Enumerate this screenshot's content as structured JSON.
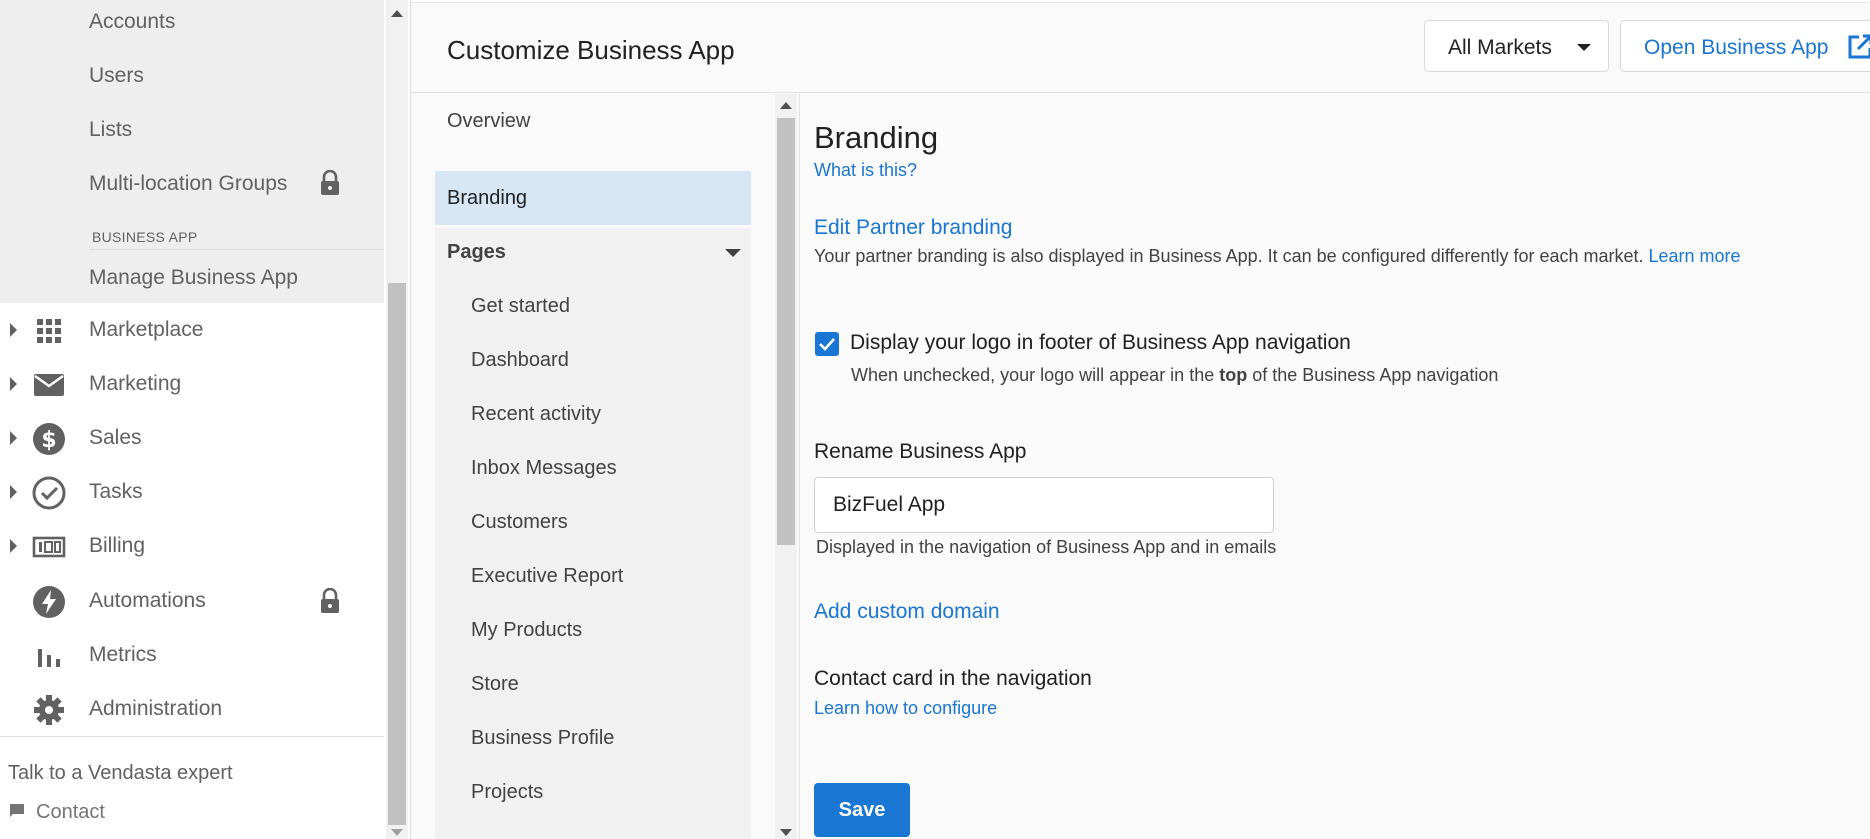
{
  "sidebar": {
    "sub_items": [
      "Accounts",
      "Users",
      "Lists",
      "Multi-location Groups"
    ],
    "section_label": "BUSINESS APP",
    "active_sub_item": "Manage Business App",
    "nav_items": [
      {
        "label": "Marketplace",
        "icon": "grid-icon",
        "expandable": true
      },
      {
        "label": "Marketing",
        "icon": "mail-icon",
        "expandable": true
      },
      {
        "label": "Sales",
        "icon": "dollar-icon",
        "expandable": true
      },
      {
        "label": "Tasks",
        "icon": "check-circle-icon",
        "expandable": true
      },
      {
        "label": "Billing",
        "icon": "billing-icon",
        "expandable": true
      },
      {
        "label": "Automations",
        "icon": "bolt-icon",
        "expandable": false,
        "locked": true
      },
      {
        "label": "Metrics",
        "icon": "bar-chart-icon",
        "expandable": false
      },
      {
        "label": "Administration",
        "icon": "gear-icon",
        "expandable": false
      }
    ],
    "talk_label": "Talk to a Vendasta expert",
    "contact_label": "Contact"
  },
  "header": {
    "title": "Customize Business App",
    "markets_label": "All Markets",
    "open_label": "Open Business App"
  },
  "subnav": {
    "overview": "Overview",
    "branding": "Branding",
    "pages_label": "Pages",
    "pages": [
      "Get started",
      "Dashboard",
      "Recent activity",
      "Inbox Messages",
      "Customers",
      "Executive Report",
      "My Products",
      "Store",
      "Business Profile",
      "Projects"
    ]
  },
  "content": {
    "title": "Branding",
    "what_is_this": "What is this?",
    "edit_partner_branding": "Edit Partner branding",
    "partner_desc": "Your partner branding is also displayed in Business App. It can be configured differently for each market.",
    "learn_more": "Learn more",
    "checkbox_label": "Display your logo in footer of Business App navigation",
    "checkbox_checked": true,
    "checkbox_hint_before": "When unchecked, your logo will appear in the",
    "checkbox_hint_bold": "top",
    "checkbox_hint_after": "of the Business App navigation",
    "rename_label": "Rename Business App",
    "rename_value": "BizFuel App",
    "rename_hint": "Displayed in the navigation of Business App and in emails",
    "add_domain": "Add custom domain",
    "contact_card_label": "Contact card in the navigation",
    "learn_configure": "Learn how to configure",
    "save_label": "Save"
  },
  "colors": {
    "accent": "#1976d2",
    "active_bg": "#d7e6f5",
    "sidebar_sub_bg": "#eeeeee"
  }
}
